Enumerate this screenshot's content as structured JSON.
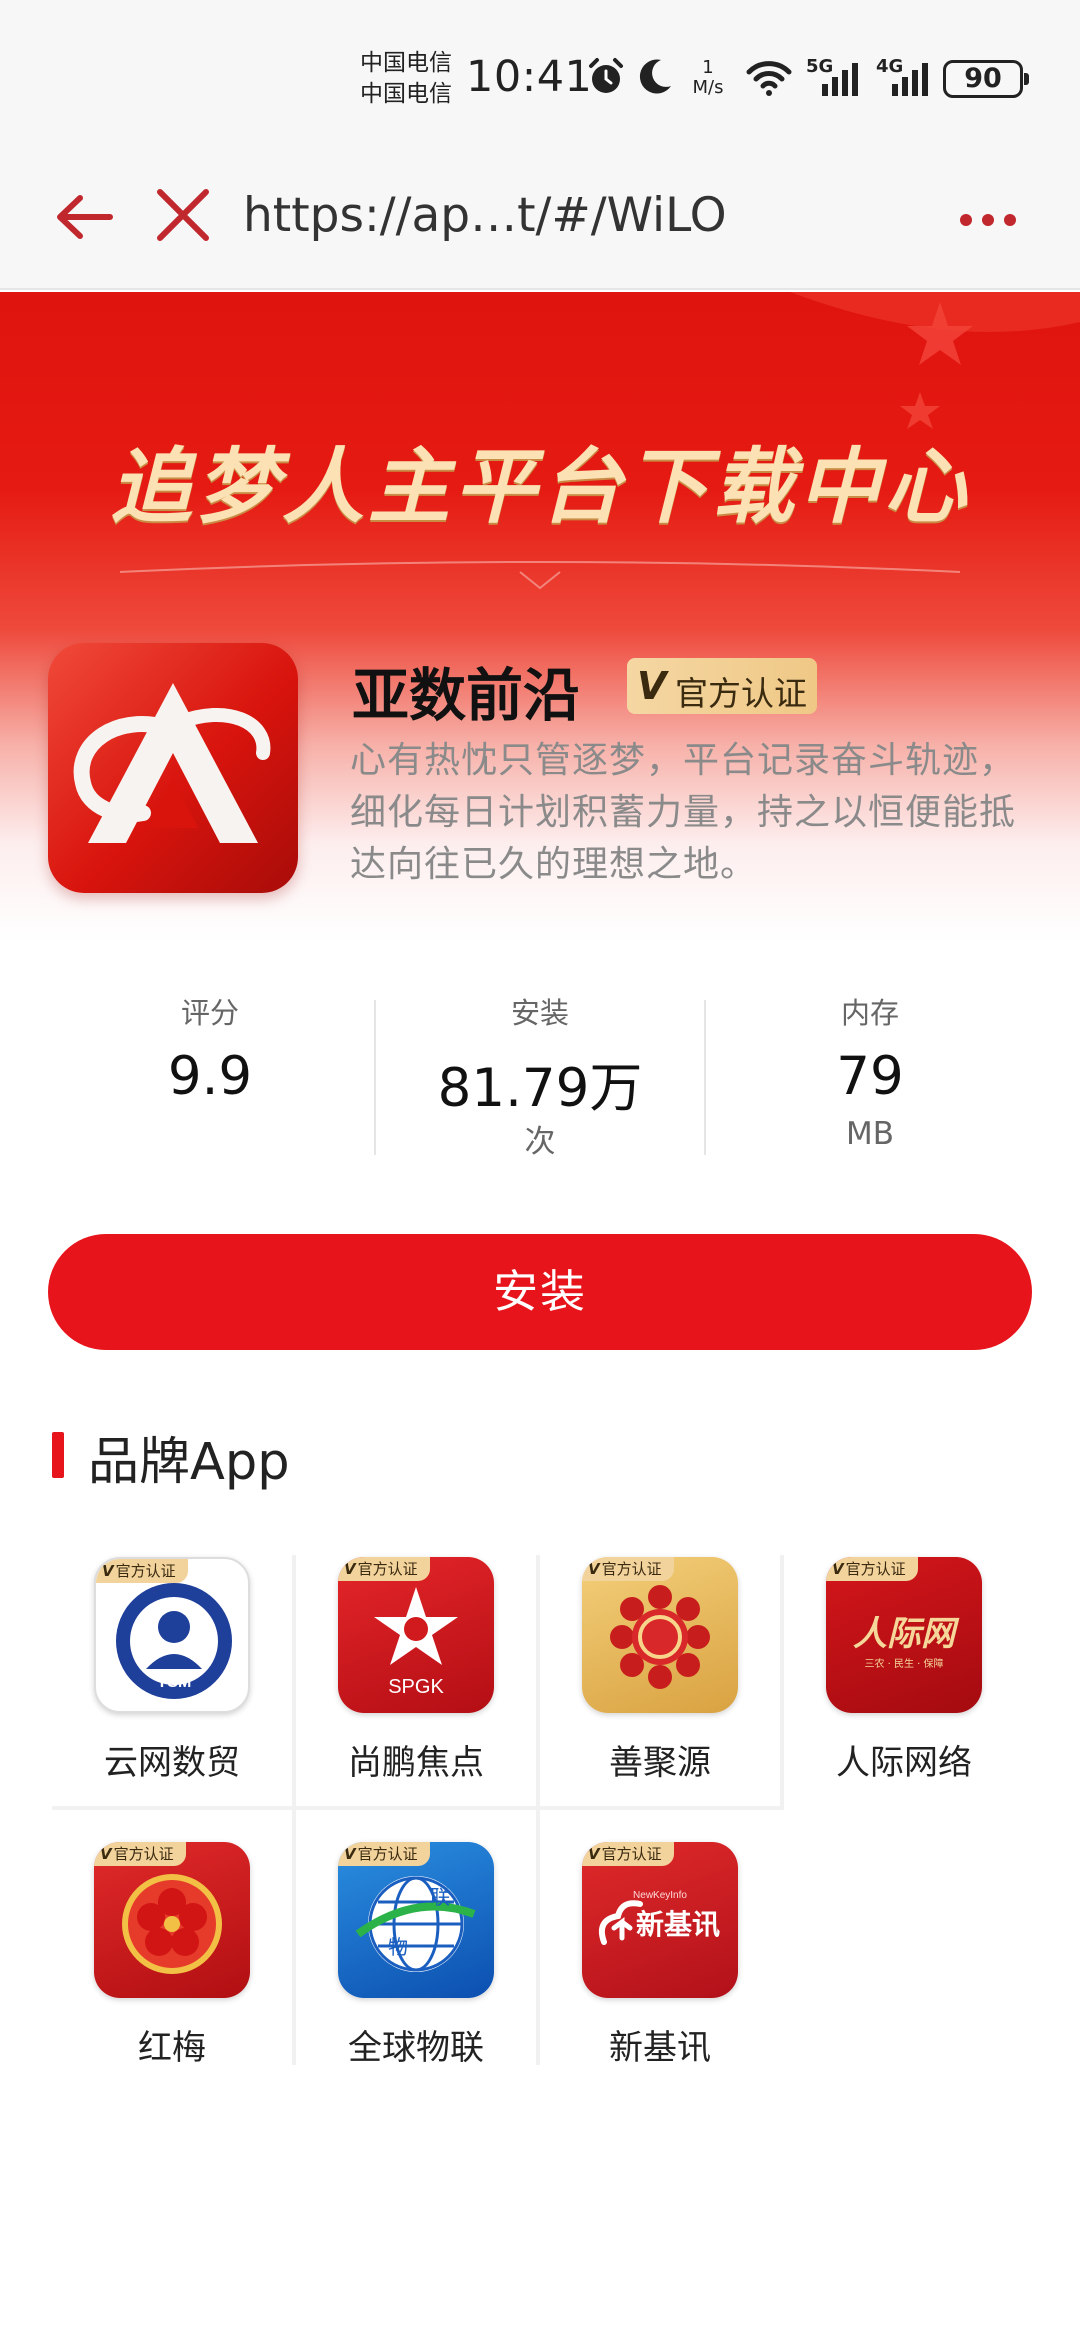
{
  "status_bar": {
    "carrier_1": "中国电信",
    "carrier_2": "中国电信",
    "time": "10:41",
    "speed_value": "1",
    "speed_unit": "M/s",
    "net_1": "5G",
    "net_2": "4G",
    "battery": "90"
  },
  "browser": {
    "url": "https://ap…t/#/WiLO"
  },
  "hero": {
    "title": "追梦人主平台下载中心"
  },
  "app": {
    "name": "亚数前沿",
    "badge_v": "V",
    "badge_text": "官方认证",
    "description": "心有热忱只管逐梦，平台记录奋斗轨迹，细化每日计划积蓄力量，持之以恒便能抵达向往已久的理想之地。"
  },
  "stats": [
    {
      "label": "评分",
      "value": "9.9",
      "unit": ""
    },
    {
      "label": "安装",
      "value": "81.79万",
      "unit": "次"
    },
    {
      "label": "内存",
      "value": "79",
      "unit": "MB"
    }
  ],
  "install_label": "安装",
  "brand_section": {
    "title": "品牌App",
    "tag_v": "V",
    "tag_text": "官方认证",
    "apps": [
      {
        "name": "云网数贸",
        "icon": "ysm-portrait-icon",
        "icon_text": "YSM"
      },
      {
        "name": "尚鹏焦点",
        "icon": "spgk-star-icon",
        "icon_text": "SPGK"
      },
      {
        "name": "善聚源",
        "icon": "shou-flower-icon",
        "icon_text": ""
      },
      {
        "name": "人际网络",
        "icon": "renjiwang-logo-icon",
        "icon_text": "人际网",
        "icon_subtext": "三农 · 民生 · 保障"
      },
      {
        "name": "红梅",
        "icon": "plum-blossom-icon",
        "icon_text": ""
      },
      {
        "name": "全球物联",
        "icon": "globe-wulian-icon",
        "icon_text": "物",
        "icon_text_2": "联"
      },
      {
        "name": "新基讯",
        "icon": "xinjixun-cloud-icon",
        "icon_text": "新基讯",
        "icon_subtext": "NewKeyInfo"
      }
    ]
  },
  "colors": {
    "brand_red": "#e8141b",
    "gold": "#fbe1b3",
    "badge_gold": "#f3d39c"
  }
}
